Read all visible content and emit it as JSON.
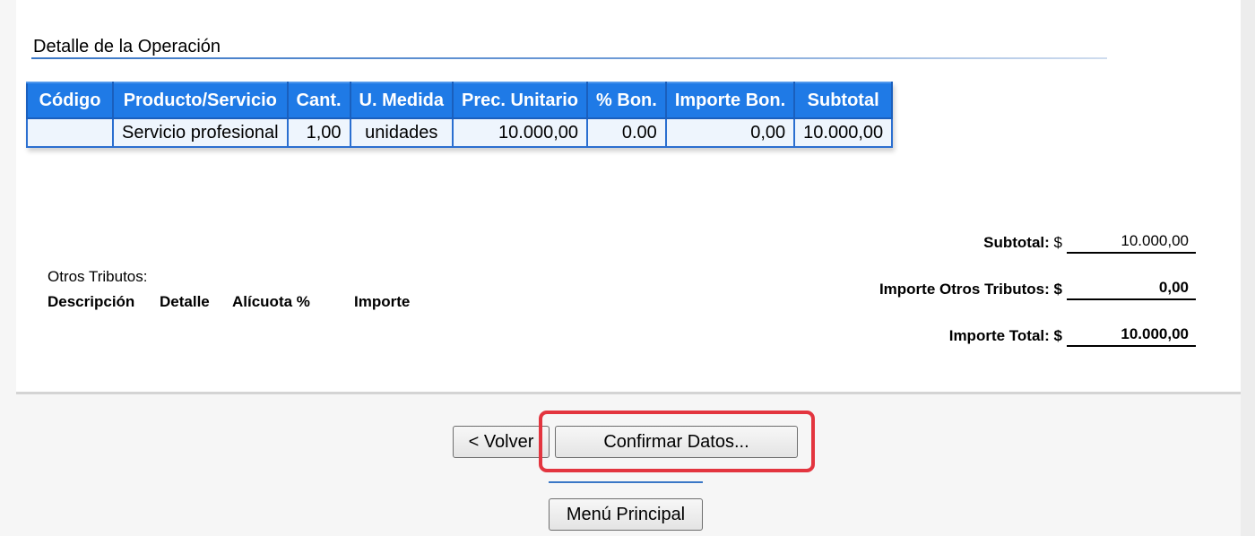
{
  "section": {
    "title": "Detalle de la Operación"
  },
  "detail_table": {
    "headers": [
      "Código",
      "Producto/Servicio",
      "Cant.",
      "U. Medida",
      "Prec. Unitario",
      "% Bon.",
      "Importe Bon.",
      "Subtotal"
    ],
    "rows": [
      [
        "",
        "Servicio profesional",
        "1,00",
        "unidades",
        "10.000,00",
        "0.00",
        "0,00",
        "10.000,00"
      ]
    ]
  },
  "otros_tributos": {
    "label": "Otros Tributos:",
    "headers": [
      "Descripción",
      "Detalle",
      "Alícuota %",
      "Importe"
    ]
  },
  "totals": {
    "subtotal": {
      "label": "Subtotal:",
      "currency": "$",
      "value": "10.000,00"
    },
    "otros": {
      "label": "Importe Otros Tributos:",
      "currency": "$",
      "value": "0,00"
    },
    "total": {
      "label": "Importe Total:",
      "currency": "$",
      "value": "10.000,00"
    }
  },
  "buttons": {
    "back": "< Volver",
    "confirm": "Confirmar Datos...",
    "menu": "Menú Principal"
  },
  "colors": {
    "header_bg": "#1f7ae6",
    "cell_bg": "#eef5fd",
    "highlight": "#e3353f"
  }
}
